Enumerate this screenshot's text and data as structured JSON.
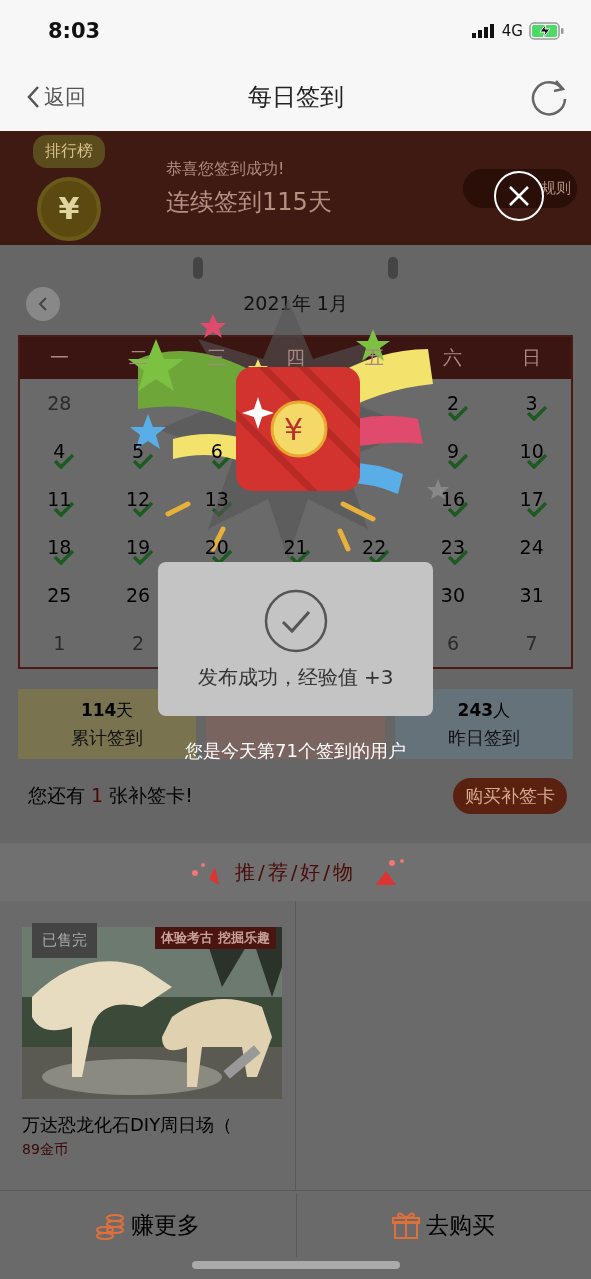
{
  "status_bar": {
    "time": "8:03",
    "network": "4G"
  },
  "nav": {
    "back": "返回",
    "title": "每日签到"
  },
  "banner": {
    "rank_badge": "排行榜",
    "coin": "¥",
    "greeting": "恭喜您签到成功!",
    "streak": "连续签到115天",
    "rules_button": "规则"
  },
  "calendar": {
    "month": "2021年 1月",
    "weekdays": [
      "一",
      "二",
      "三",
      "四",
      "五",
      "六",
      "日"
    ],
    "rows": [
      [
        {
          "day": "28",
          "muted": true,
          "checked": false
        },
        null,
        null,
        null,
        null,
        {
          "day": "2",
          "muted": false,
          "checked": true
        },
        {
          "day": "3",
          "muted": false,
          "checked": true
        }
      ],
      [
        {
          "day": "4",
          "muted": false,
          "checked": true
        },
        {
          "day": "5",
          "muted": false,
          "checked": true
        },
        {
          "day": "6",
          "muted": false,
          "checked": true
        },
        null,
        null,
        {
          "day": "9",
          "muted": false,
          "checked": true
        },
        {
          "day": "10",
          "muted": false,
          "checked": true
        }
      ],
      [
        {
          "day": "11",
          "muted": false,
          "checked": true
        },
        {
          "day": "12",
          "muted": false,
          "checked": true
        },
        {
          "day": "13",
          "muted": false,
          "checked": true
        },
        null,
        null,
        {
          "day": "16",
          "muted": false,
          "checked": true
        },
        {
          "day": "17",
          "muted": false,
          "checked": true
        }
      ],
      [
        {
          "day": "18",
          "muted": false,
          "checked": true
        },
        {
          "day": "19",
          "muted": false,
          "checked": true
        },
        {
          "day": "20",
          "muted": false,
          "checked": true
        },
        {
          "day": "21",
          "muted": false,
          "checked": true
        },
        {
          "day": "22",
          "muted": false,
          "checked": true
        },
        {
          "day": "23",
          "muted": false,
          "checked": true
        },
        {
          "day": "24",
          "muted": false,
          "checked": false
        }
      ],
      [
        {
          "day": "25",
          "muted": false,
          "checked": false
        },
        {
          "day": "26",
          "muted": false,
          "checked": false
        },
        null,
        null,
        null,
        {
          "day": "30",
          "muted": false,
          "checked": false
        },
        {
          "day": "31",
          "muted": false,
          "checked": false
        }
      ],
      [
        {
          "day": "1",
          "muted": true,
          "checked": false
        },
        {
          "day": "2",
          "muted": true,
          "checked": false
        },
        null,
        null,
        null,
        {
          "day": "6",
          "muted": true,
          "checked": false
        },
        {
          "day": "7",
          "muted": true,
          "checked": false
        }
      ]
    ]
  },
  "stats": [
    {
      "value": "114",
      "unit": "天",
      "label": "累计签到",
      "color": "#7a7350"
    },
    {
      "color": "#7a6460"
    },
    {
      "value": "243",
      "unit": "人",
      "label": "昨日签到",
      "color": "#66727a"
    }
  ],
  "makeup": {
    "before": "您还有",
    "count": "1",
    "after": "张补签卡!",
    "button": "购买补签卡"
  },
  "section_title": "推/荐/好/物",
  "products": [
    {
      "badge": "已售完",
      "tag": "体验考古 挖掘乐趣",
      "name": "万达恐龙化石DIY周日场（",
      "price": "89金币"
    }
  ],
  "bottom_bar": [
    {
      "kind": "coins",
      "label": "赚更多"
    },
    {
      "kind": "gift",
      "label": "去购买"
    }
  ],
  "popup": {
    "coin": "¥",
    "toast": "发布成功，经验值 +3",
    "subtitle": "您是今天第71个签到的用户"
  }
}
